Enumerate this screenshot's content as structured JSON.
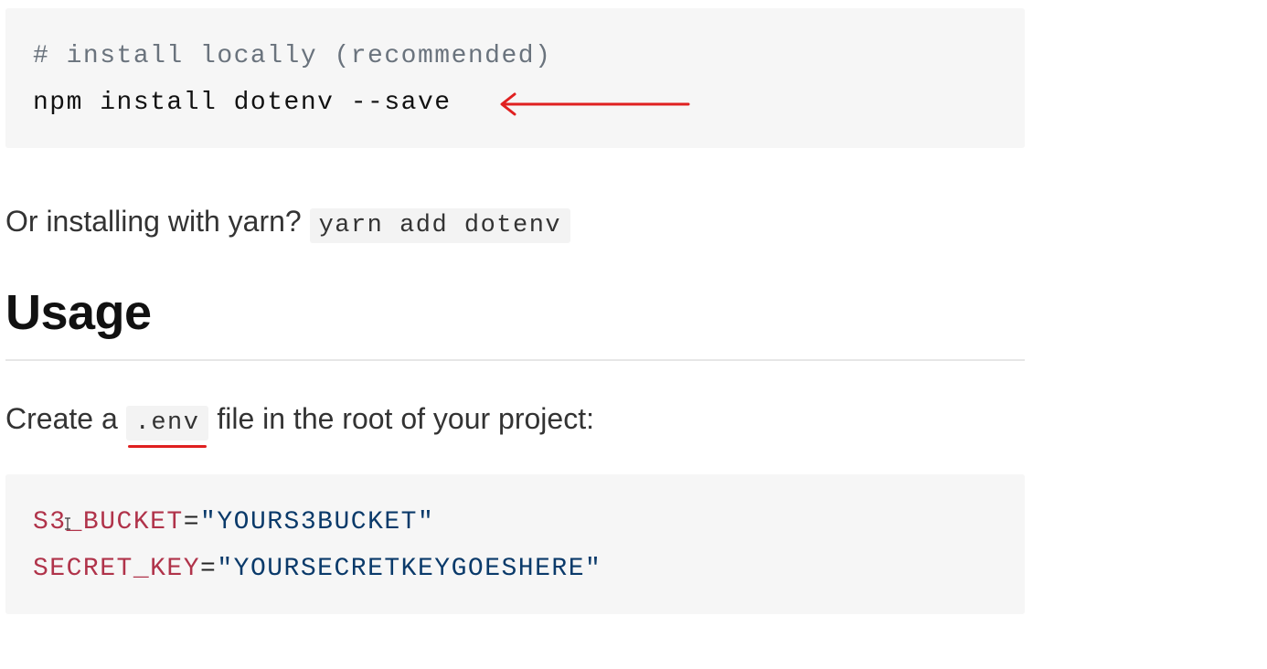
{
  "install_block": {
    "comment": "# install locally (recommended)",
    "command": "npm install dotenv --save"
  },
  "yarn_paragraph": {
    "text": "Or installing with yarn?",
    "code": "yarn add dotenv"
  },
  "usage_heading": "Usage",
  "create_paragraph": {
    "before": "Create a",
    "code": ".env",
    "after": "file in the root of your project:"
  },
  "env_block": {
    "lines": [
      {
        "key": "S3_BUCKET",
        "eq": "=",
        "value": "\"YOURS3BUCKET\""
      },
      {
        "key": "SECRET_KEY",
        "eq": "=",
        "value": "\"YOURSECRETKEYGOESHERE\""
      }
    ]
  },
  "colors": {
    "annotation": "#e02020",
    "code_background": "#f6f6f6",
    "env_key": "#b0334a",
    "env_value": "#0a3a6a",
    "comment": "#6a737d"
  },
  "icons": {
    "annotation_arrow": "arrow-left-icon",
    "text_cursor": "text-cursor-icon"
  }
}
